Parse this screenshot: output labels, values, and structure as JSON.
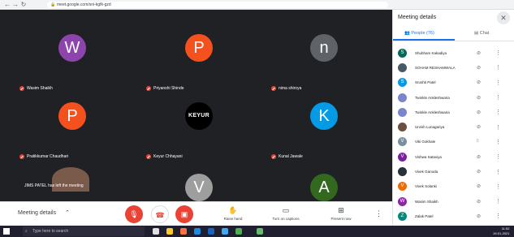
{
  "browser": {
    "url": "meet.google.com/sni-kgfk-gzd"
  },
  "tiles": [
    {
      "name": "Wasim Shaikh",
      "initial": "W",
      "color": "#8e44ad"
    },
    {
      "name": "Priyanshi Shinde",
      "initial": "P",
      "color": "#f4511e"
    },
    {
      "name": "nima shiroya",
      "initial": "n",
      "color": "#5f6368"
    },
    {
      "name": "Pratikkumar Chaudhari",
      "initial": "P",
      "color": "#f4511e"
    },
    {
      "name": "Keyur Chhayani",
      "initial": "KEYUR",
      "color": "#000000"
    },
    {
      "name": "Kunal Jawale",
      "initial": "K",
      "color": "#039be5"
    },
    {
      "name": "",
      "initial": "",
      "color": "#7a5a4a"
    },
    {
      "name": "",
      "initial": "V",
      "color": "#9e9e9e"
    },
    {
      "name": "",
      "initial": "A",
      "color": "#33691e"
    }
  ],
  "toast": "JIMS PATEL has left the meeting",
  "bottombar": {
    "meeting_details": "Meeting details",
    "raise_hand": "Raise hand",
    "captions": "Turn on captions",
    "present": "Present now"
  },
  "panel": {
    "title": "Meeting details",
    "tab_people": "People (76)",
    "tab_chat": "Chat",
    "people": [
      {
        "name": "Shubham Kakadiya",
        "initial": "S",
        "color": "#00695c",
        "live": false
      },
      {
        "name": "SOHAM RESHAMWALA",
        "initial": "",
        "color": "#455a64",
        "live": false
      },
      {
        "name": "Srushti Patel",
        "initial": "S",
        "color": "#039be5",
        "live": false
      },
      {
        "name": "Twinkle Ankleshwaria",
        "initial": "",
        "color": "#7986cb",
        "live": false
      },
      {
        "name": "Twinkle Ankleshwaria",
        "initial": "",
        "color": "#7986cb",
        "live": false
      },
      {
        "name": "Urvish Lunagariya",
        "initial": "",
        "color": "#6d4c41",
        "live": false
      },
      {
        "name": "Viki Gokhale",
        "initial": "V",
        "color": "#78909c",
        "live": true
      },
      {
        "name": "Vishwa Sataviya",
        "initial": "V",
        "color": "#7b1fa2",
        "live": false
      },
      {
        "name": "Vivek Ganoda",
        "initial": "",
        "color": "#263238",
        "live": false
      },
      {
        "name": "Vivek Solanki",
        "initial": "V",
        "color": "#ef6c00",
        "live": false
      },
      {
        "name": "Wasim Shaikh",
        "initial": "W",
        "color": "#8e24aa",
        "live": false
      },
      {
        "name": "Zalak Patel",
        "initial": "Z",
        "color": "#00897b",
        "live": false
      }
    ]
  },
  "taskbar": {
    "search": "Type here to search",
    "time": "11:52",
    "date": "19-01-2021"
  }
}
